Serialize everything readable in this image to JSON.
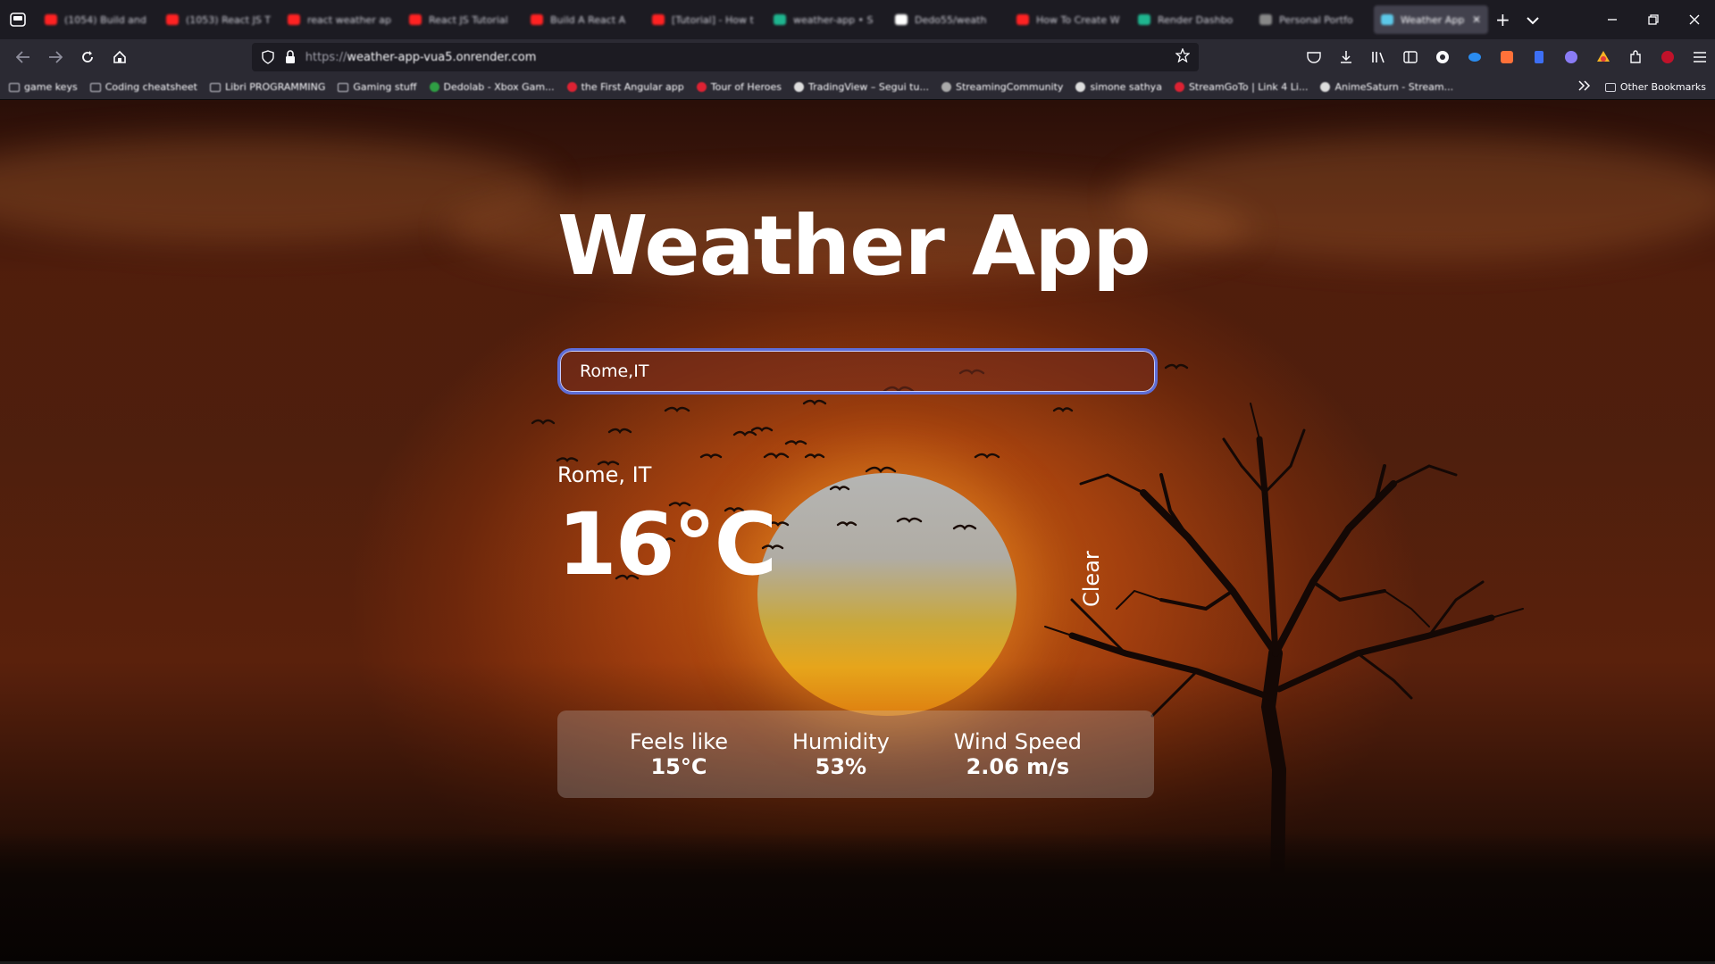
{
  "browser": {
    "tabs": [
      {
        "label": "(1054) Build and",
        "icon": "youtube-icon",
        "color": "#ff2222"
      },
      {
        "label": "(1053) React JS T",
        "icon": "youtube-icon",
        "color": "#ff2222"
      },
      {
        "label": "react weather ap",
        "icon": "youtube-icon",
        "color": "#ff2222"
      },
      {
        "label": "React JS Tutorial",
        "icon": "youtube-icon",
        "color": "#ff2222"
      },
      {
        "label": "Build A React A",
        "icon": "youtube-icon",
        "color": "#ff2222"
      },
      {
        "label": "[Tutorial] - How t",
        "icon": "youtube-icon",
        "color": "#ff2222"
      },
      {
        "label": "weather-app • S",
        "icon": "code-icon",
        "color": "#1fb58f"
      },
      {
        "label": "Dedo55/weath",
        "icon": "github-icon",
        "color": "#ffffff"
      },
      {
        "label": "How To Create W",
        "icon": "youtube-icon",
        "color": "#ff2222"
      },
      {
        "label": "Render Dashbo",
        "icon": "code-icon",
        "color": "#1fb58f"
      },
      {
        "label": "Personal Portfo",
        "icon": "globe-icon",
        "color": "#888888"
      },
      {
        "label": "Weather App",
        "icon": "globe-icon",
        "color": "#5cc8e8",
        "active": true
      }
    ],
    "url_prefix": "https://",
    "url_host": "weather-app-vua5.onrender.com",
    "bookmarks": [
      {
        "label": "game keys",
        "icon": "folder-icon"
      },
      {
        "label": "Coding cheatsheet",
        "icon": "folder-icon"
      },
      {
        "label": "Libri PROGRAMMING",
        "icon": "folder-icon"
      },
      {
        "label": "Gaming stuff",
        "icon": "folder-icon"
      },
      {
        "label": "Dedolab - Xbox Gam...",
        "icon": "site-icon",
        "color": "#2f9e44"
      },
      {
        "label": "the First Angular app",
        "icon": "site-icon",
        "color": "#dd2233"
      },
      {
        "label": "Tour of Heroes",
        "icon": "site-icon",
        "color": "#dd2233"
      },
      {
        "label": "TradingView – Segui tu...",
        "icon": "site-icon",
        "color": "#dddddd"
      },
      {
        "label": "StreamingCommunity",
        "icon": "site-icon",
        "color": "#aaaaaa"
      },
      {
        "label": "simone sathya",
        "icon": "site-icon",
        "color": "#dddddd"
      },
      {
        "label": "StreamGoTo | Link 4 Li...",
        "icon": "site-icon",
        "color": "#dd2233"
      },
      {
        "label": "AnimeSaturn - Stream...",
        "icon": "site-icon",
        "color": "#dddddd"
      }
    ],
    "other_bookmarks": "Other Bookmarks"
  },
  "app": {
    "title": "Weather App",
    "search": {
      "value": "Rome,IT",
      "placeholder": ""
    },
    "location": "Rome, IT",
    "temperature": "16°C",
    "condition": "Clear",
    "details": [
      {
        "label": "Feels like",
        "value": "15°C"
      },
      {
        "label": "Humidity",
        "value": "53%"
      },
      {
        "label": "Wind Speed",
        "value": "2.06 m/s"
      }
    ]
  },
  "colors": {
    "accent_focus": "#5d6dd8",
    "text": "#ffffff"
  }
}
